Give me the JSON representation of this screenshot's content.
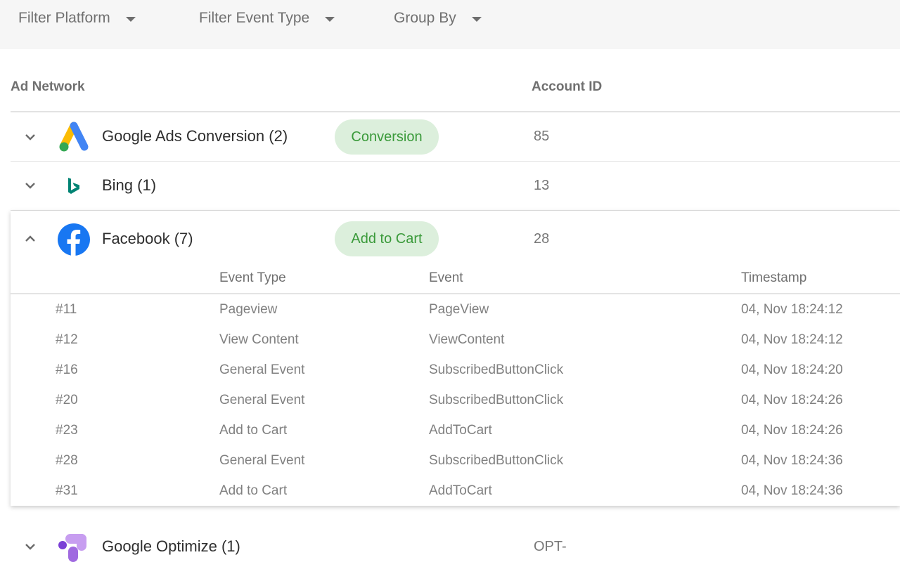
{
  "filters": {
    "platform": "Filter Platform",
    "event_type": "Filter Event Type",
    "group_by": "Group By"
  },
  "table": {
    "headers": {
      "ad_network": "Ad Network",
      "account_id": "Account ID"
    },
    "networks": [
      {
        "name": "Google Ads Conversion (2)",
        "badge": "Conversion",
        "account": "85",
        "logo": "google-ads-logo",
        "expanded": false
      },
      {
        "name": "Bing (1)",
        "badge": "",
        "account": "13",
        "logo": "bing-logo",
        "expanded": false
      },
      {
        "name": "Facebook (7)",
        "badge": "Add to Cart",
        "account": "28",
        "logo": "facebook-logo",
        "expanded": true
      },
      {
        "name": "Google Optimize (1)",
        "badge": "",
        "account": "OPT-",
        "logo": "google-optimize-logo",
        "expanded": false
      }
    ]
  },
  "facebook_events": {
    "headers": {
      "event_type": "Event Type",
      "event": "Event",
      "timestamp": "Timestamp"
    },
    "rows": [
      {
        "id": "#11",
        "type": "Pageview",
        "event": "PageView",
        "timestamp": "04, Nov 18:24:12"
      },
      {
        "id": "#12",
        "type": "View Content",
        "event": "ViewContent",
        "timestamp": "04, Nov 18:24:12"
      },
      {
        "id": "#16",
        "type": "General Event",
        "event": "SubscribedButtonClick",
        "timestamp": "04, Nov 18:24:20"
      },
      {
        "id": "#20",
        "type": "General Event",
        "event": "SubscribedButtonClick",
        "timestamp": "04, Nov 18:24:26"
      },
      {
        "id": "#23",
        "type": "Add to Cart",
        "event": "AddToCart",
        "timestamp": "04, Nov 18:24:26"
      },
      {
        "id": "#28",
        "type": "General Event",
        "event": "SubscribedButtonClick",
        "timestamp": "04, Nov 18:24:36"
      },
      {
        "id": "#31",
        "type": "Add to Cart",
        "event": "AddToCart",
        "timestamp": "04, Nov 18:24:36"
      }
    ]
  },
  "colors": {
    "badge_bg": "#dcefdc",
    "badge_text": "#3a9a3a",
    "facebook_blue": "#1877f2",
    "bing_teal": "#008373"
  }
}
